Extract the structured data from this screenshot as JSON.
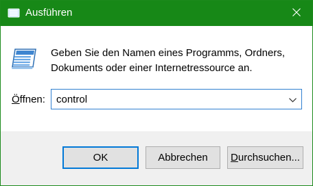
{
  "window": {
    "title": "Ausführen",
    "accent_color": "#178817",
    "title_icon": "run-dialog-icon",
    "close_icon": "close-icon"
  },
  "content": {
    "icon": "run-program-icon",
    "description": "Geben Sie den Namen eines Programms, Ordners, Dokuments oder einer Internetressource an.",
    "open_label_accel": "Ö",
    "open_label_rest": "ffnen:",
    "open_value": "control",
    "dropdown_icon": "chevron-down-icon"
  },
  "buttons": {
    "ok_label": "OK",
    "cancel_label": "Abbrechen",
    "browse_label_accel": "D",
    "browse_label_rest": "urchsuchen..."
  }
}
